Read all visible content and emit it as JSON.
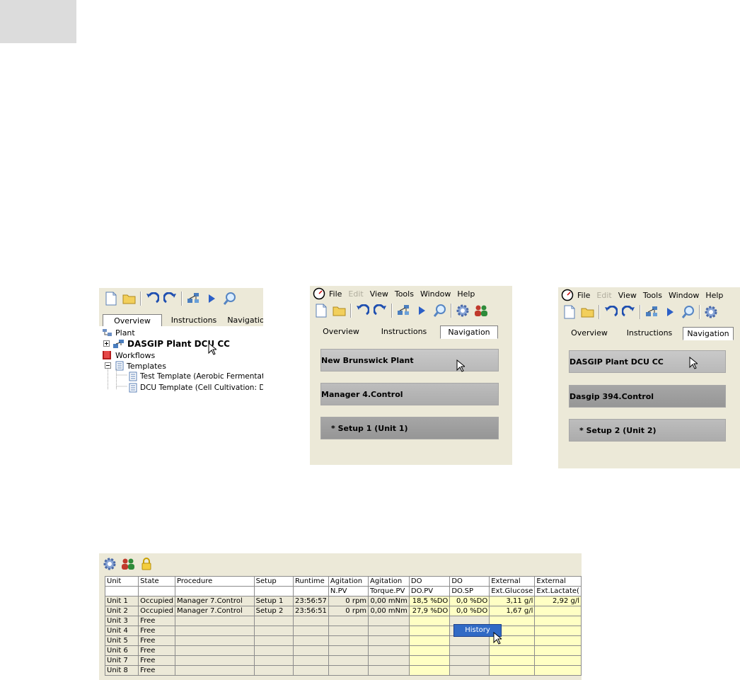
{
  "tree_panel": {
    "tabs": [
      "Overview",
      "Instructions",
      "Navigation"
    ],
    "items": {
      "plant": "Plant",
      "dasgip": "DASGIP Plant DCU CC",
      "workflows": "Workflows",
      "templates": "Templates",
      "test_template": "Test Template (Aerobic Fermentation:",
      "dcu_template": "DCU Template (Cell Cultivation: DCU)"
    }
  },
  "nav_panel_1": {
    "menu": [
      "File",
      "Edit",
      "View",
      "Tools",
      "Window",
      "Help"
    ],
    "tabs": [
      "Overview",
      "Instructions",
      "Navigation"
    ],
    "buttons": [
      "New Brunswick Plant",
      "Manager 4.Control",
      "*  Setup 1 (Unit 1)"
    ]
  },
  "nav_panel_2": {
    "menu": [
      "File",
      "Edit",
      "View",
      "Tools",
      "Window",
      "Help"
    ],
    "tabs": [
      "Overview",
      "Instructions",
      "Navigation"
    ],
    "buttons": [
      "DASGIP Plant DCU CC",
      "Dasgip 394.Control",
      "*  Setup 2 (Unit 2)"
    ]
  },
  "grid": {
    "header1": [
      "Unit",
      "State",
      "Procedure",
      "Setup",
      "Runtime",
      "Agitation",
      "Agitation",
      "DO",
      "DO",
      "External",
      "External"
    ],
    "header2": [
      "",
      "",
      "",
      "",
      "",
      "N.PV",
      "Torque.PV",
      "DO.PV",
      "DO.SP",
      "Ext.Glucose",
      "Ext.Lactate("
    ],
    "rows": [
      [
        "Unit 1",
        "Occupied",
        "Manager 7.Control",
        "Setup 1",
        "23:56:57",
        "0 rpm",
        "0,00 mNm",
        "18,5 %DO",
        "0,0 %DO",
        "3,11 g/l",
        "2,92 g/l"
      ],
      [
        "Unit 2",
        "Occupied",
        "Manager 7.Control",
        "Setup 2",
        "23:56:51",
        "0 rpm",
        "0,00 mNm",
        "27,9 %DO",
        "0,0 %DO",
        "1,67 g/l",
        ""
      ],
      [
        "Unit 3",
        "Free",
        "",
        "",
        "",
        "",
        "",
        "",
        "",
        "",
        ""
      ],
      [
        "Unit 4",
        "Free",
        "",
        "",
        "",
        "",
        "",
        "",
        "",
        "",
        ""
      ],
      [
        "Unit 5",
        "Free",
        "",
        "",
        "",
        "",
        "",
        "",
        "",
        "",
        ""
      ],
      [
        "Unit 6",
        "Free",
        "",
        "",
        "",
        "",
        "",
        "",
        "",
        "",
        ""
      ],
      [
        "Unit 7",
        "Free",
        "",
        "",
        "",
        "",
        "",
        "",
        "",
        "",
        ""
      ],
      [
        "Unit 8",
        "Free",
        "",
        "",
        "",
        "",
        "",
        "",
        "",
        "",
        ""
      ]
    ],
    "context_menu": "History"
  }
}
